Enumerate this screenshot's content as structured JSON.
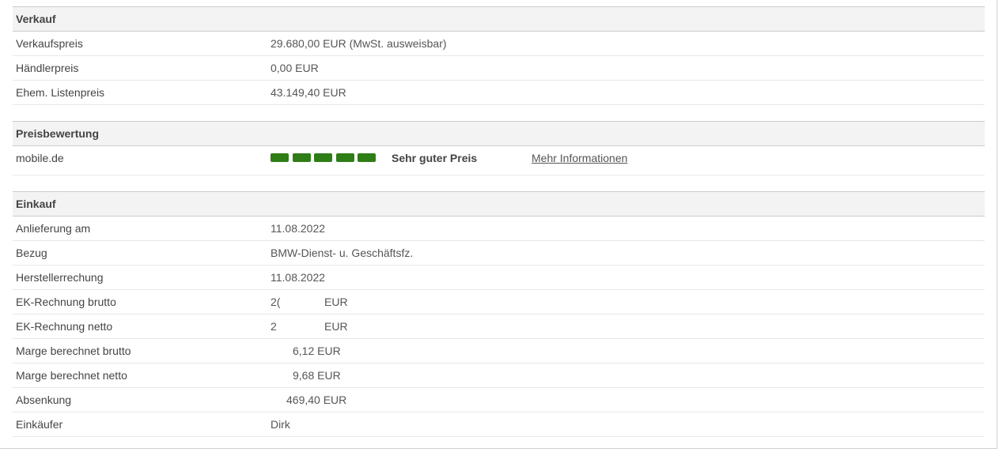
{
  "verkauf": {
    "title": "Verkauf",
    "rows": [
      {
        "label": "Verkaufspreis",
        "value": "29.680,00 EUR (MwSt. ausweisbar)"
      },
      {
        "label": "Händlerpreis",
        "value": "0,00 EUR"
      },
      {
        "label": "Ehem. Listenpreis",
        "value": "43.149,40 EUR"
      }
    ]
  },
  "preisbewertung": {
    "title": "Preisbewertung",
    "source_label": "mobile.de",
    "rating_level": 5,
    "rating_max": 5,
    "rating_color": "#2e7d16",
    "rating_text": "Sehr guter Preis",
    "more_link": "Mehr Informationen"
  },
  "einkauf": {
    "title": "Einkauf",
    "rows": [
      {
        "label": "Anlieferung am",
        "value": "11.08.2022"
      },
      {
        "label": "Bezug",
        "value": "BMW-Dienst- u. Geschäftsfz."
      },
      {
        "label": "Herstellerrechung",
        "value": "11.08.2022"
      },
      {
        "label": "EK-Rechnung brutto",
        "value_prefix": "2(",
        "value_suffix": "EUR"
      },
      {
        "label": "EK-Rechnung netto",
        "value_prefix": "2",
        "value_suffix": "EUR"
      },
      {
        "label": "Marge berechnet brutto",
        "value_suffix": "6,12 EUR"
      },
      {
        "label": "Marge berechnet netto",
        "value_suffix": "9,68 EUR"
      },
      {
        "label": "Absenkung",
        "value_suffix": "469,40 EUR"
      },
      {
        "label": "Einkäufer",
        "value": "Dirk"
      }
    ]
  }
}
